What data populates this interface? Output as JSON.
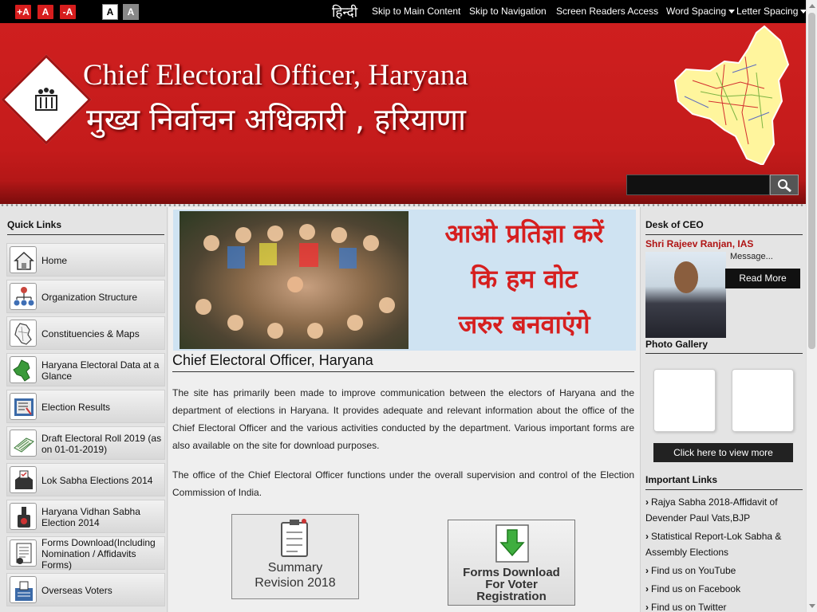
{
  "topbar": {
    "font_increase": "+A",
    "font_normal": "A",
    "font_decrease": "-A",
    "contrast_white": "A",
    "contrast_grey": "A",
    "hindi": "हिन्दी",
    "skip_main": "Skip to Main Content",
    "skip_nav": "Skip to Navigation",
    "screen_readers": "Screen Readers Access",
    "word_spacing": "Word Spacing",
    "letter_spacing": "Letter Spacing"
  },
  "header": {
    "title_en": "Chief Electoral Officer, Haryana",
    "title_hi": "मुख्य निर्वाचन अधिकारी , हरियाणा",
    "search_placeholder": ""
  },
  "quick_links": {
    "title": "Quick Links",
    "items": [
      {
        "label": "Home",
        "icon": "home-icon"
      },
      {
        "label": "Organization Structure",
        "icon": "org-chart-icon"
      },
      {
        "label": "Constituencies & Maps",
        "icon": "map-outline-icon"
      },
      {
        "label": "Haryana Electoral Data at a Glance",
        "icon": "haryana-map-icon"
      },
      {
        "label": "Election Results",
        "icon": "results-icon"
      },
      {
        "label": "Draft Electoral Roll 2019 (as on 01-01-2019)",
        "icon": "electoral-roll-icon"
      },
      {
        "label": "Lok Sabha Elections 2014",
        "icon": "ballot-box-icon"
      },
      {
        "label": "Haryana Vidhan Sabha Election 2014",
        "icon": "voting-icon"
      },
      {
        "label": "Forms Download(Including Nomination / Affidavits Forms)",
        "icon": "forms-icon"
      },
      {
        "label": "Overseas Voters",
        "icon": "overseas-voters-icon"
      }
    ]
  },
  "main": {
    "banner_text": [
      "आओ प्रतिज्ञा करें",
      "कि हम वोट",
      "जरुर बनवाएंगे"
    ],
    "title": "Chief Electoral Officer, Haryana",
    "para1": "The site has primarily been made to improve communication between the electors of Haryana and the department of elections in Haryana. It provides adequate and relevant information about the office of the Chief Electoral Officer and the various activities conducted by the department. Various important forms are also available on the site for download purposes.",
    "para2": "The office of the Chief Electoral Officer functions under the overall supervision and control of the Election Commission of India.",
    "tile1_line1": "Summary",
    "tile1_line2": "Revision 2018",
    "tile2_line1": "Forms Download",
    "tile2_line2": "For Voter",
    "tile2_line3": "Registration"
  },
  "right": {
    "desk_title": "Desk of CEO",
    "ceo_name": "Shri Rajeev Ranjan, IAS",
    "message": "Message...",
    "read_more": "Read More",
    "gallery_title": "Photo Gallery",
    "view_more": "Click here to view more",
    "important_title": "Important Links",
    "links": [
      "Rajya Sabha 2018-Affidavit of Devender Paul Vats,BJP",
      "Statistical Report-Lok Sabha & Assembly Elections",
      "Find us on YouTube",
      "Find us on Facebook",
      "Find us on Twitter"
    ]
  },
  "colors": {
    "header_red": "#cf1f1f",
    "accent_red": "#d71d1d",
    "ceo_name_red": "#b01414"
  }
}
